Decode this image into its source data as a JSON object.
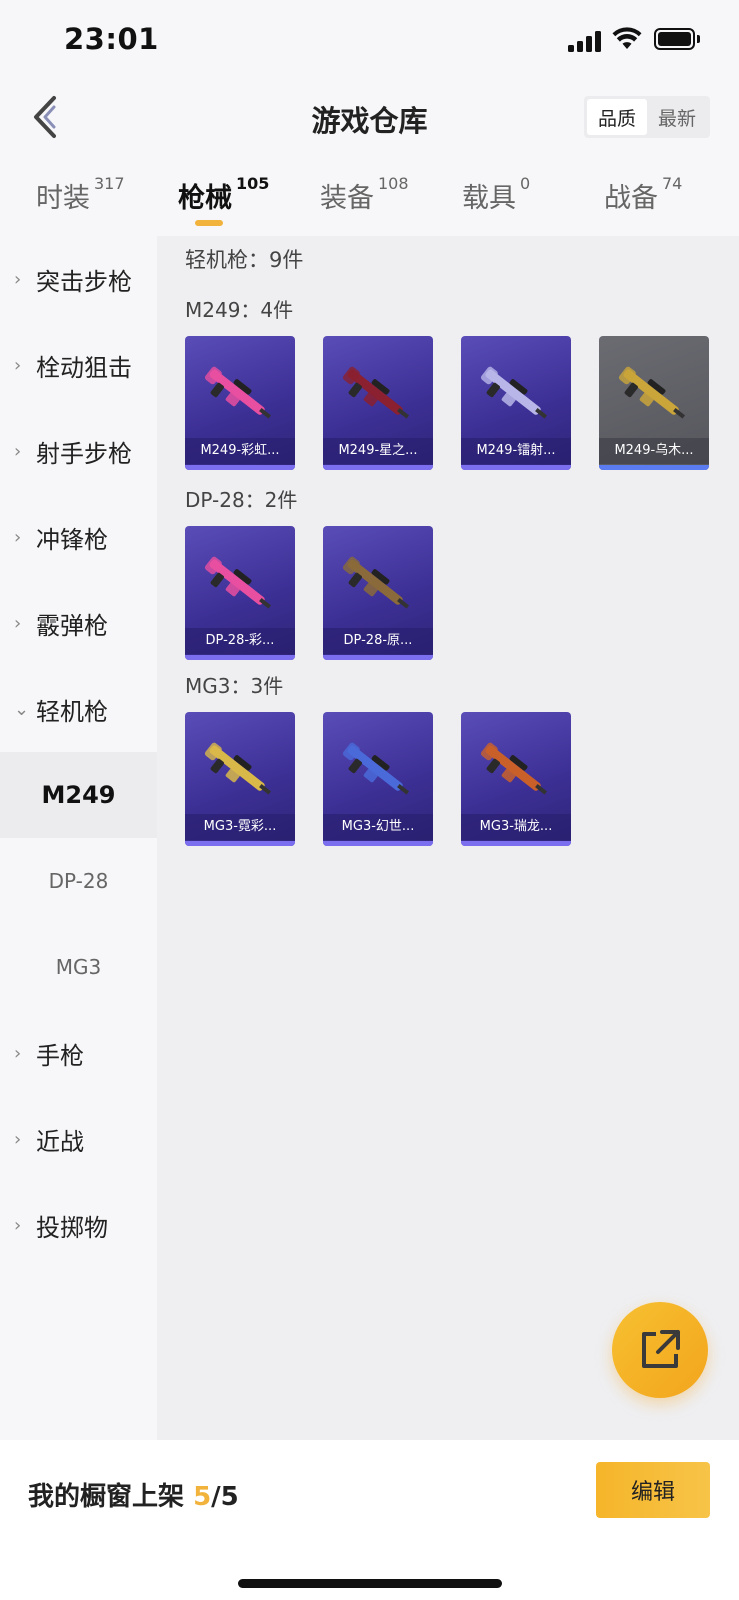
{
  "status_bar": {
    "time": "23:01"
  },
  "header": {
    "title": "游戏仓库",
    "sort_options": [
      "品质",
      "最新"
    ],
    "active_sort": "品质"
  },
  "tabs": [
    {
      "label": "时装",
      "count": "317"
    },
    {
      "label": "枪械",
      "count": "105"
    },
    {
      "label": "装备",
      "count": "108"
    },
    {
      "label": "载具",
      "count": "0"
    },
    {
      "label": "战备",
      "count": "74"
    }
  ],
  "active_tab": "枪械",
  "sidebar": {
    "items_top": [
      {
        "label": "突击步枪",
        "chevron": "›"
      },
      {
        "label": "栓动狙击",
        "chevron": "›"
      },
      {
        "label": "射手步枪",
        "chevron": "›"
      },
      {
        "label": "冲锋枪",
        "chevron": "›"
      },
      {
        "label": "霰弹枪",
        "chevron": "›"
      },
      {
        "label": "轻机枪",
        "chevron": "⌄"
      }
    ],
    "sub_items": [
      "M249",
      "DP-28",
      "MG3"
    ],
    "active_sub": "M249",
    "items_bottom": [
      {
        "label": "手枪",
        "chevron": "›"
      },
      {
        "label": "近战",
        "chevron": "›"
      },
      {
        "label": "投掷物",
        "chevron": "›"
      }
    ]
  },
  "content": {
    "category_heading": "轻机枪：9件",
    "groups": [
      {
        "heading": "M249：4件",
        "items": [
          {
            "name": "M249-彩虹...",
            "color": "#e84fa0"
          },
          {
            "name": "M249-星之...",
            "color": "#8a2030"
          },
          {
            "name": "M249-镭射...",
            "color": "#b8b6e8"
          },
          {
            "name": "M249-乌木...",
            "color": "#c9a53a"
          }
        ]
      },
      {
        "heading": "DP-28：2件",
        "items": [
          {
            "name": "DP-28-彩...",
            "color": "#e84fa0"
          },
          {
            "name": "DP-28-原...",
            "color": "#8a6a3a"
          }
        ]
      },
      {
        "heading": "MG3：3件",
        "items": [
          {
            "name": "MG3-霓彩...",
            "color": "#d9b84a"
          },
          {
            "name": "MG3-幻世...",
            "color": "#4a6ad9"
          },
          {
            "name": "MG3-瑞龙...",
            "color": "#c9602a"
          }
        ]
      }
    ]
  },
  "bottom_bar": {
    "label": "我的橱窗上架",
    "current": "5",
    "separator": "/",
    "total": "5",
    "edit_label": "编辑"
  },
  "colors": {
    "accent": "#f2b33d",
    "card_purple": "#3d3096"
  }
}
